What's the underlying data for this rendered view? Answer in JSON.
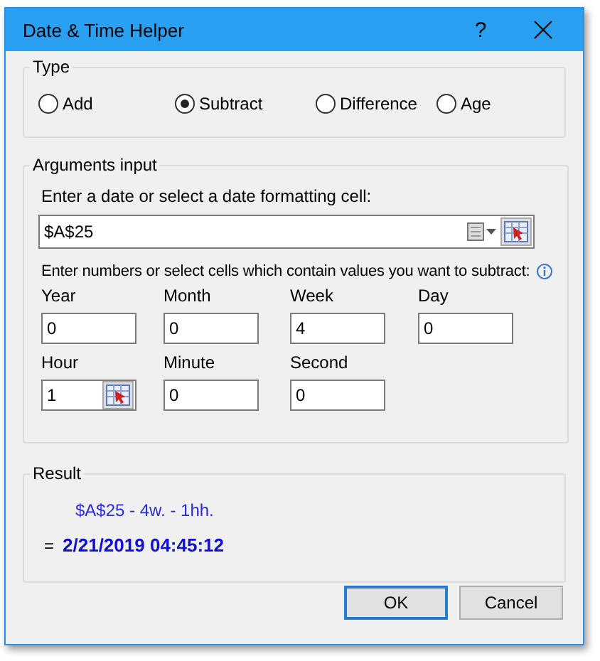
{
  "window": {
    "title": "Date & Time Helper",
    "help": "?"
  },
  "type_group": {
    "legend": "Type",
    "options": [
      {
        "label": "Add",
        "selected": false
      },
      {
        "label": "Subtract",
        "selected": true
      },
      {
        "label": "Difference",
        "selected": false
      },
      {
        "label": "Age",
        "selected": false
      }
    ]
  },
  "arguments": {
    "legend": "Arguments input",
    "date_prompt": "Enter a date or select a date formatting cell:",
    "date_value": "$A$25",
    "numbers_prompt": "Enter numbers or select cells which contain values you want to subtract:",
    "fields": [
      {
        "label": "Year",
        "value": "0",
        "kind": "plain"
      },
      {
        "label": "Month",
        "value": "0",
        "kind": "plain"
      },
      {
        "label": "Week",
        "value": "4",
        "kind": "plain"
      },
      {
        "label": "Day",
        "value": "0",
        "kind": "plain"
      },
      {
        "label": "Hour",
        "value": "1",
        "kind": "picker"
      },
      {
        "label": "Minute",
        "value": "0",
        "kind": "plain"
      },
      {
        "label": "Second",
        "value": "0",
        "kind": "plain"
      }
    ]
  },
  "result": {
    "legend": "Result",
    "formula": "$A$25 - 4w. - 1hh.",
    "equals": "=",
    "value": "2/21/2019 04:45:12"
  },
  "buttons": [
    {
      "label": "OK",
      "default": true
    },
    {
      "label": "Cancel",
      "default": false
    }
  ]
}
